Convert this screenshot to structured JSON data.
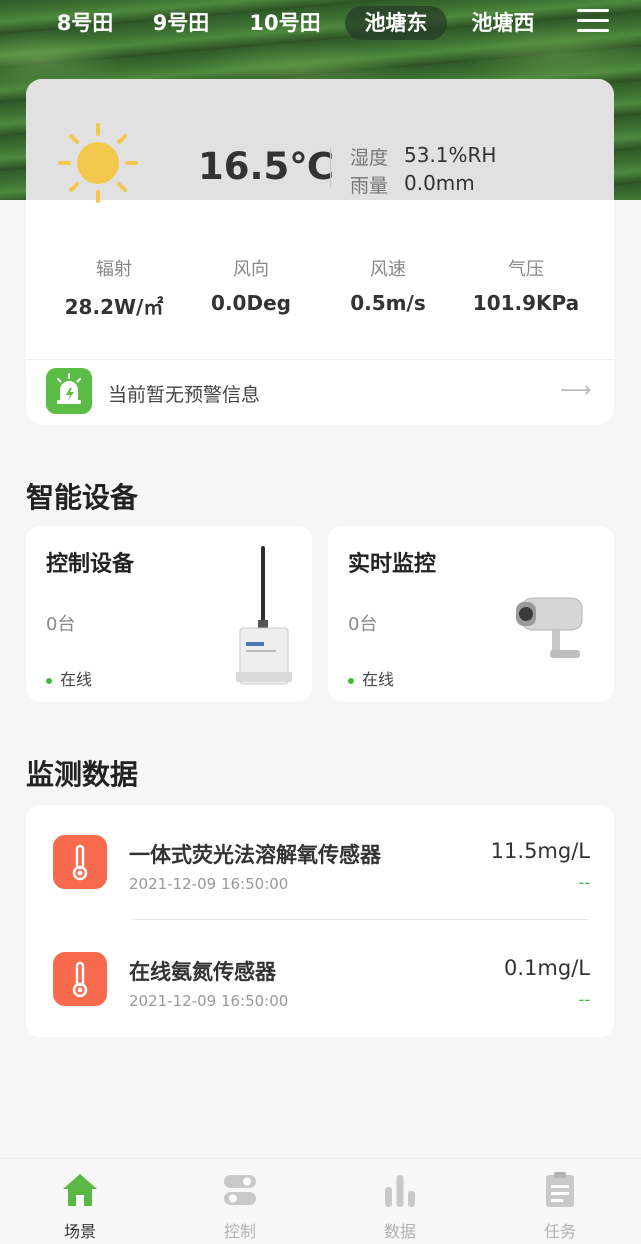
{
  "tabs": [
    "8号田",
    "9号田",
    "10号田",
    "池塘东",
    "池塘西"
  ],
  "active_tab": "池塘东",
  "weather": {
    "icon": "sun-icon",
    "temperature": "16.5℃",
    "humidity_label": "湿度",
    "humidity_value": "53.1%RH",
    "rain_label": "雨量",
    "rain_value": "0.0mm",
    "metrics": [
      {
        "label": "辐射",
        "value": "28.2W/㎡"
      },
      {
        "label": "风向",
        "value": "0.0Deg"
      },
      {
        "label": "风速",
        "value": "0.5m/s"
      },
      {
        "label": "气压",
        "value": "101.9KPa"
      }
    ]
  },
  "alert": {
    "icon": "alarm-icon",
    "text": "当前暂无预警信息",
    "arrow": "⟶"
  },
  "devices_section": {
    "title": "智能设备",
    "cards": [
      {
        "title": "控制设备",
        "count": "0台",
        "status": "在线",
        "icon": "wireless-controller-icon"
      },
      {
        "title": "实时监控",
        "count": "0台",
        "status": "在线",
        "icon": "security-camera-icon"
      }
    ]
  },
  "monitor_section": {
    "title": "监测数据",
    "items": [
      {
        "name": "一体式荧光法溶解氧传感器",
        "time": "2021-12-09 16:50:00",
        "value": "11.5mg/L",
        "trend": "--",
        "icon": "thermometer-icon"
      },
      {
        "name": "在线氨氮传感器",
        "time": "2021-12-09 16:50:00",
        "value": "0.1mg/L",
        "trend": "--",
        "icon": "thermometer-icon"
      }
    ]
  },
  "bottom_nav": [
    {
      "label": "场景",
      "icon": "home-icon",
      "active": true
    },
    {
      "label": "控制",
      "icon": "toggle-icon",
      "active": false
    },
    {
      "label": "数据",
      "icon": "bar-chart-icon",
      "active": false
    },
    {
      "label": "任务",
      "icon": "clipboard-icon",
      "active": false
    }
  ],
  "colors": {
    "accent_green": "#4cae3b",
    "alert_red": "#f5573a",
    "online_dot": "#3fbb3a"
  }
}
